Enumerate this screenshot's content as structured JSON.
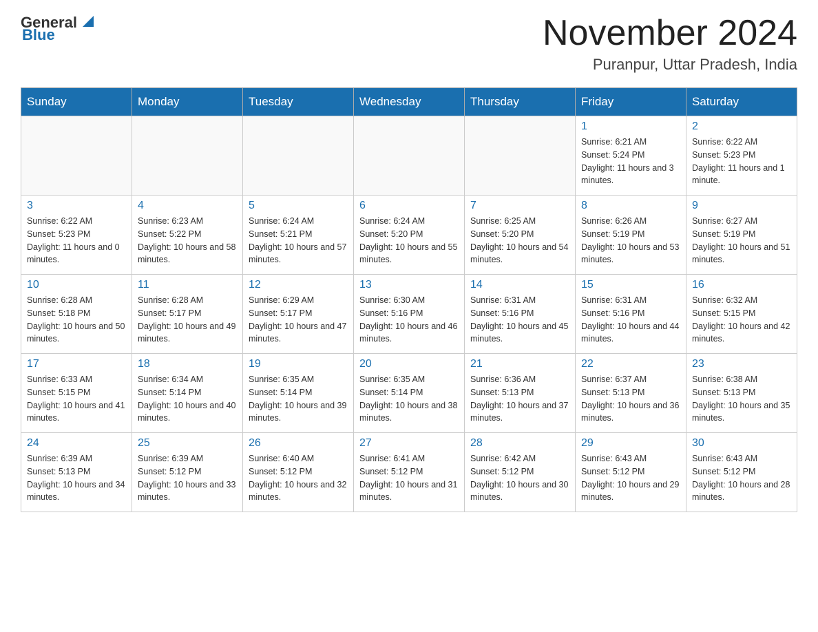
{
  "header": {
    "logo_general": "General",
    "logo_blue": "Blue",
    "month_title": "November 2024",
    "location": "Puranpur, Uttar Pradesh, India"
  },
  "weekdays": [
    "Sunday",
    "Monday",
    "Tuesday",
    "Wednesday",
    "Thursday",
    "Friday",
    "Saturday"
  ],
  "weeks": [
    [
      {
        "day": "",
        "info": ""
      },
      {
        "day": "",
        "info": ""
      },
      {
        "day": "",
        "info": ""
      },
      {
        "day": "",
        "info": ""
      },
      {
        "day": "",
        "info": ""
      },
      {
        "day": "1",
        "info": "Sunrise: 6:21 AM\nSunset: 5:24 PM\nDaylight: 11 hours and 3 minutes."
      },
      {
        "day": "2",
        "info": "Sunrise: 6:22 AM\nSunset: 5:23 PM\nDaylight: 11 hours and 1 minute."
      }
    ],
    [
      {
        "day": "3",
        "info": "Sunrise: 6:22 AM\nSunset: 5:23 PM\nDaylight: 11 hours and 0 minutes."
      },
      {
        "day": "4",
        "info": "Sunrise: 6:23 AM\nSunset: 5:22 PM\nDaylight: 10 hours and 58 minutes."
      },
      {
        "day": "5",
        "info": "Sunrise: 6:24 AM\nSunset: 5:21 PM\nDaylight: 10 hours and 57 minutes."
      },
      {
        "day": "6",
        "info": "Sunrise: 6:24 AM\nSunset: 5:20 PM\nDaylight: 10 hours and 55 minutes."
      },
      {
        "day": "7",
        "info": "Sunrise: 6:25 AM\nSunset: 5:20 PM\nDaylight: 10 hours and 54 minutes."
      },
      {
        "day": "8",
        "info": "Sunrise: 6:26 AM\nSunset: 5:19 PM\nDaylight: 10 hours and 53 minutes."
      },
      {
        "day": "9",
        "info": "Sunrise: 6:27 AM\nSunset: 5:19 PM\nDaylight: 10 hours and 51 minutes."
      }
    ],
    [
      {
        "day": "10",
        "info": "Sunrise: 6:28 AM\nSunset: 5:18 PM\nDaylight: 10 hours and 50 minutes."
      },
      {
        "day": "11",
        "info": "Sunrise: 6:28 AM\nSunset: 5:17 PM\nDaylight: 10 hours and 49 minutes."
      },
      {
        "day": "12",
        "info": "Sunrise: 6:29 AM\nSunset: 5:17 PM\nDaylight: 10 hours and 47 minutes."
      },
      {
        "day": "13",
        "info": "Sunrise: 6:30 AM\nSunset: 5:16 PM\nDaylight: 10 hours and 46 minutes."
      },
      {
        "day": "14",
        "info": "Sunrise: 6:31 AM\nSunset: 5:16 PM\nDaylight: 10 hours and 45 minutes."
      },
      {
        "day": "15",
        "info": "Sunrise: 6:31 AM\nSunset: 5:16 PM\nDaylight: 10 hours and 44 minutes."
      },
      {
        "day": "16",
        "info": "Sunrise: 6:32 AM\nSunset: 5:15 PM\nDaylight: 10 hours and 42 minutes."
      }
    ],
    [
      {
        "day": "17",
        "info": "Sunrise: 6:33 AM\nSunset: 5:15 PM\nDaylight: 10 hours and 41 minutes."
      },
      {
        "day": "18",
        "info": "Sunrise: 6:34 AM\nSunset: 5:14 PM\nDaylight: 10 hours and 40 minutes."
      },
      {
        "day": "19",
        "info": "Sunrise: 6:35 AM\nSunset: 5:14 PM\nDaylight: 10 hours and 39 minutes."
      },
      {
        "day": "20",
        "info": "Sunrise: 6:35 AM\nSunset: 5:14 PM\nDaylight: 10 hours and 38 minutes."
      },
      {
        "day": "21",
        "info": "Sunrise: 6:36 AM\nSunset: 5:13 PM\nDaylight: 10 hours and 37 minutes."
      },
      {
        "day": "22",
        "info": "Sunrise: 6:37 AM\nSunset: 5:13 PM\nDaylight: 10 hours and 36 minutes."
      },
      {
        "day": "23",
        "info": "Sunrise: 6:38 AM\nSunset: 5:13 PM\nDaylight: 10 hours and 35 minutes."
      }
    ],
    [
      {
        "day": "24",
        "info": "Sunrise: 6:39 AM\nSunset: 5:13 PM\nDaylight: 10 hours and 34 minutes."
      },
      {
        "day": "25",
        "info": "Sunrise: 6:39 AM\nSunset: 5:12 PM\nDaylight: 10 hours and 33 minutes."
      },
      {
        "day": "26",
        "info": "Sunrise: 6:40 AM\nSunset: 5:12 PM\nDaylight: 10 hours and 32 minutes."
      },
      {
        "day": "27",
        "info": "Sunrise: 6:41 AM\nSunset: 5:12 PM\nDaylight: 10 hours and 31 minutes."
      },
      {
        "day": "28",
        "info": "Sunrise: 6:42 AM\nSunset: 5:12 PM\nDaylight: 10 hours and 30 minutes."
      },
      {
        "day": "29",
        "info": "Sunrise: 6:43 AM\nSunset: 5:12 PM\nDaylight: 10 hours and 29 minutes."
      },
      {
        "day": "30",
        "info": "Sunrise: 6:43 AM\nSunset: 5:12 PM\nDaylight: 10 hours and 28 minutes."
      }
    ]
  ]
}
